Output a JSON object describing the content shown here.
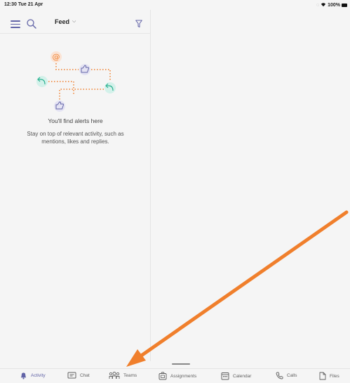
{
  "status_bar": {
    "time": "12:30",
    "date": "Tue 21 Apr",
    "battery": "100%"
  },
  "header": {
    "view_label": "Feed"
  },
  "empty_state": {
    "title": "You'll find alerts here",
    "description": "Stay on top of relevant activity, such as mentions, likes and replies."
  },
  "tabs": [
    {
      "label": "Activity",
      "icon": "bell-icon",
      "active": true
    },
    {
      "label": "Chat",
      "icon": "chat-icon",
      "active": false
    },
    {
      "label": "Teams",
      "icon": "teams-icon",
      "active": false
    },
    {
      "label": "Assignments",
      "icon": "assignments-icon",
      "active": false
    },
    {
      "label": "Calendar",
      "icon": "calendar-icon",
      "active": false
    },
    {
      "label": "Calls",
      "icon": "phone-icon",
      "active": false
    },
    {
      "label": "Files",
      "icon": "file-icon",
      "active": false
    }
  ],
  "colors": {
    "accent": "#6264a7",
    "arrow": "#f07f2c",
    "mention": "#f07f2c",
    "reply": "#2fb292"
  }
}
